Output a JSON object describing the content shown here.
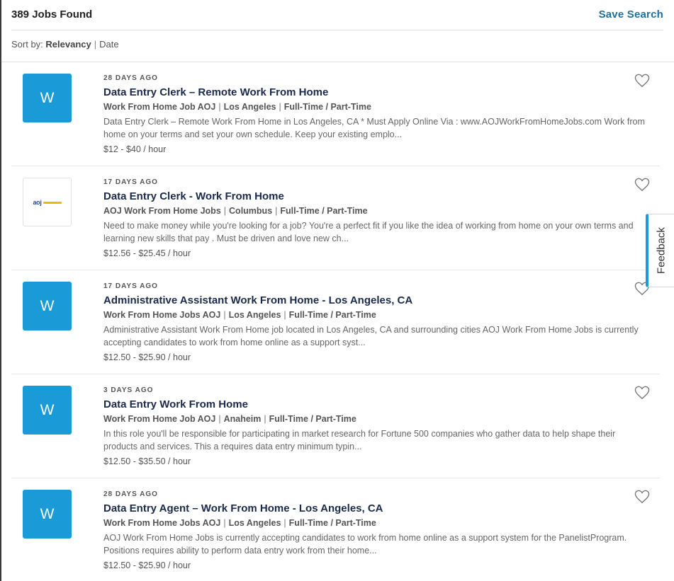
{
  "header": {
    "jobs_found": "389 Jobs Found",
    "save_search": "Save Search"
  },
  "sort": {
    "label": "Sort by:",
    "options": [
      "Relevancy",
      "Date"
    ],
    "active": "Relevancy"
  },
  "feedback_label": "Feedback",
  "colors": {
    "logo_blue": "#1a9bd7",
    "link_blue": "#1f6f9e",
    "title_navy": "#1b2a4a"
  },
  "jobs": [
    {
      "age": "28 DAYS AGO",
      "logo_type": "letter",
      "logo_letter": "W",
      "title": "Data Entry Clerk – Remote Work From Home",
      "company": "Work From Home Job AOJ",
      "location": "Los Angeles",
      "type": "Full-Time / Part-Time",
      "description": "Data Entry Clerk – Remote Work From Home in Los Angeles, CA * Must Apply Online Via : www.AOJWorkFromHomeJobs.com Work from home on your terms and set your own schedule. Keep your existing emplo...",
      "pay": "$12 - $40 / hour",
      "icon": "heart-icon"
    },
    {
      "age": "17 DAYS AGO",
      "logo_type": "image",
      "logo_letter": "",
      "title": "Data Entry Clerk - Work From Home",
      "company": "AOJ Work From Home Jobs",
      "location": "Columbus",
      "type": "Full-Time / Part-Time",
      "description": "Need to make money while you're looking for a job? You're a perfect fit if you like the idea of working from home on your own terms and learning new skills that pay . Must be driven and love new ch...",
      "pay": "$12.56 - $25.45 / hour",
      "icon": "heart-icon"
    },
    {
      "age": "17 DAYS AGO",
      "logo_type": "letter",
      "logo_letter": "W",
      "title": "Administrative Assistant Work From Home - Los Angeles, CA",
      "company": "Work From Home Jobs AOJ",
      "location": "Los Angeles",
      "type": "Full-Time / Part-Time",
      "description": "Administrative Assistant Work From Home job located in Los Angeles, CA and surrounding cities AOJ Work From Home Jobs is currently accepting candidates to work from home online as a support syst...",
      "pay": "$12.50 - $25.90 / hour",
      "icon": "heart-icon"
    },
    {
      "age": "3 DAYS AGO",
      "logo_type": "letter",
      "logo_letter": "W",
      "title": "Data Entry Work From Home",
      "company": "Work From Home Job AOJ",
      "location": "Anaheim",
      "type": "Full-Time / Part-Time",
      "description": "In this role you'll be responsible for participating in market research for Fortune 500 companies who gather data to help shape their products and services. This a requires data entry minimum typin...",
      "pay": "$12.50 - $35.50 / hour",
      "icon": "heart-icon"
    },
    {
      "age": "28 DAYS AGO",
      "logo_type": "letter",
      "logo_letter": "W",
      "title": "Data Entry Agent – Work From Home - Los Angeles, CA",
      "company": "Work From Home Jobs AOJ",
      "location": "Los Angeles",
      "type": "Full-Time / Part-Time",
      "description": "AOJ Work From Home Jobs is currently accepting candidates to work from home online as a support system for the PanelistProgram. Positions requires ability to perform data entry work from their home...",
      "pay": "$12.50 - $25.90 / hour",
      "icon": "heart-icon"
    }
  ]
}
